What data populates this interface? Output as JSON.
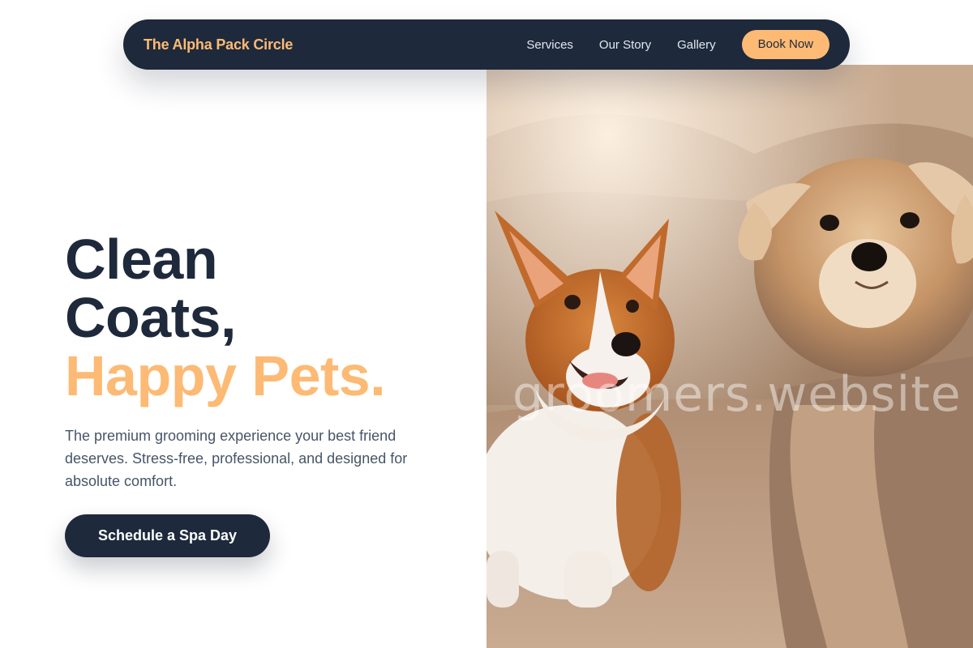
{
  "nav": {
    "brand": "The Alpha Pack Circle",
    "links": [
      "Services",
      "Our Story",
      "Gallery"
    ],
    "cta_label": "Book Now"
  },
  "hero": {
    "headline_line1": "Clean",
    "headline_line2": "Coats,",
    "headline_accent": "Happy Pets.",
    "subtitle": "The premium grooming experience your best friend deserves. Stress-free, professional, and designed for absolute comfort.",
    "cta_label": "Schedule a Spa Day",
    "image_watermark": "groomers.website"
  },
  "colors": {
    "navy": "#1e293b",
    "accent": "#fdba74",
    "body_text": "#475569"
  }
}
